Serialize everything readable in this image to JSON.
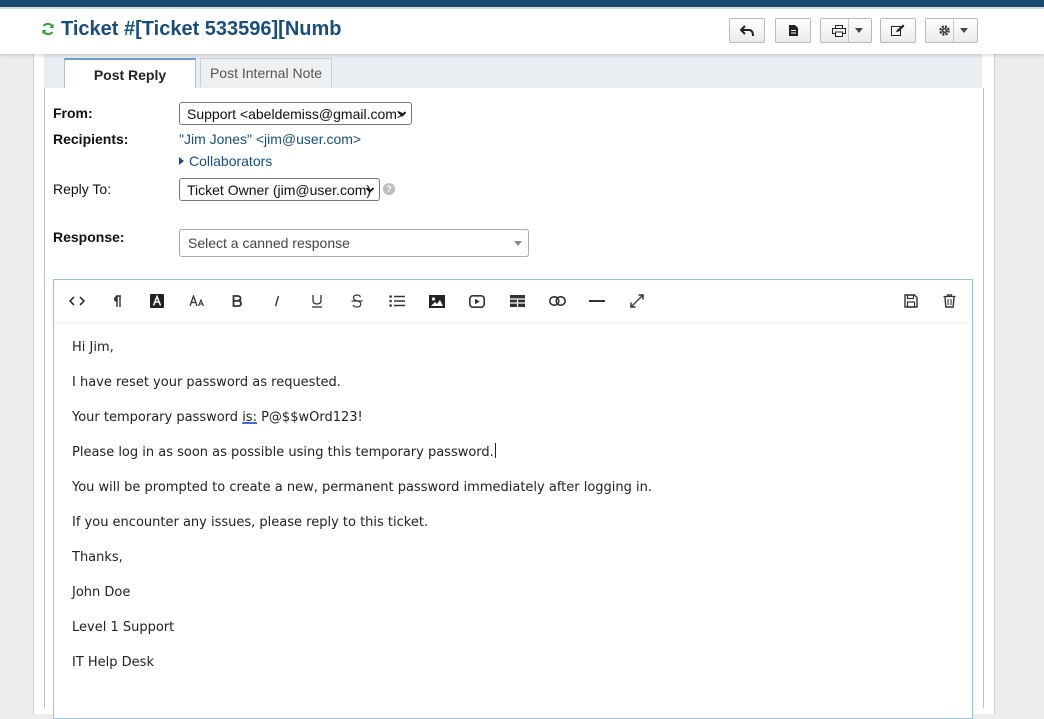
{
  "header": {
    "title": "Ticket #[Ticket 533596][Numb"
  },
  "tabs": [
    {
      "label": "Post Reply",
      "active": true
    },
    {
      "label": "Post Internal Note",
      "active": false
    }
  ],
  "form": {
    "from_label": "From:",
    "from_value": "Support <abeldemiss@gmail.com>",
    "recipients_label": "Recipients:",
    "recipients_value": "\"Jim Jones\" <jim@user.com>",
    "collaborators_label": "Collaborators",
    "reply_to_label": "Reply To:",
    "reply_to_value": "Ticket Owner (jim@user.com)",
    "help_glyph": "?",
    "response_label": "Response:",
    "response_placeholder": "Select a canned response"
  },
  "editor": {
    "lines": {
      "greeting": "Hi Jim,",
      "l1": "I have reset your password as requested.",
      "l2a": "Your temporary password ",
      "l2b": "is:",
      "l2c": " P@$$wOrd123!",
      "l3": "Please log in as soon as possible using this temporary password.",
      "l4": "You will be prompted to create a new, permanent password immediately after logging in.",
      "l5": "If you encounter any issues, please reply to this ticket.",
      "l6": "Thanks,",
      "l7": "John Doe",
      "l8": "Level 1 Support",
      "l9": "IT Help Desk"
    }
  },
  "colors": {
    "title": "#184e7c",
    "link": "#184e7c",
    "refresh": "#2e9e3a",
    "editor_border": "#9ac3dc"
  }
}
